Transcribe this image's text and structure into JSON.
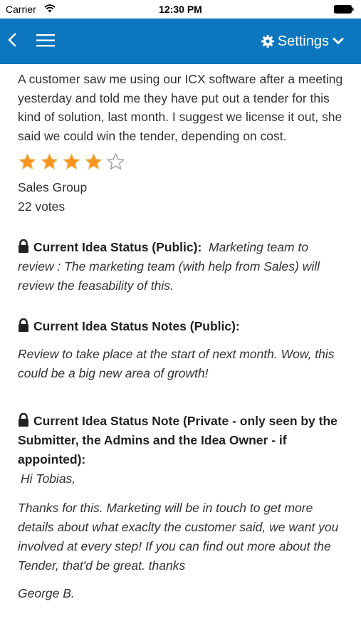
{
  "status_bar": {
    "carrier": "Carrier",
    "time": "12:30 PM"
  },
  "nav": {
    "settings_label": "Settings",
    "color": "#0c76be"
  },
  "idea": {
    "description": "A customer saw me using our ICX software after a meeting yesterday and told me they have put out a tender for this kind of solution, last month. I suggest we license it out, she said we could win the tender, depending on cost.",
    "rating": 4,
    "rating_max": 5,
    "group": "Sales Group",
    "votes": "22 votes"
  },
  "status_public": {
    "heading": "Current Idea Status (Public):",
    "value": "Marketing team to review : The marketing team (with help from Sales) will review the feasability of this."
  },
  "status_notes_public": {
    "heading": "Current Idea Status Notes (Public):",
    "text": "Review to take place at the start of next month.  Wow, this could be a big new area of growth!"
  },
  "status_note_private": {
    "heading": "Current Idea Status Note (Private - only seen by the Submitter, the Admins and the Idea Owner - if appointed):",
    "greeting": "Hi Tobias,",
    "body": "Thanks for this. Marketing will be in touch to get more details about what exaclty the customer said, we want you involved at every step! If you can find out more about the Tender, that'd be great.  thanks",
    "signature": "George B."
  }
}
